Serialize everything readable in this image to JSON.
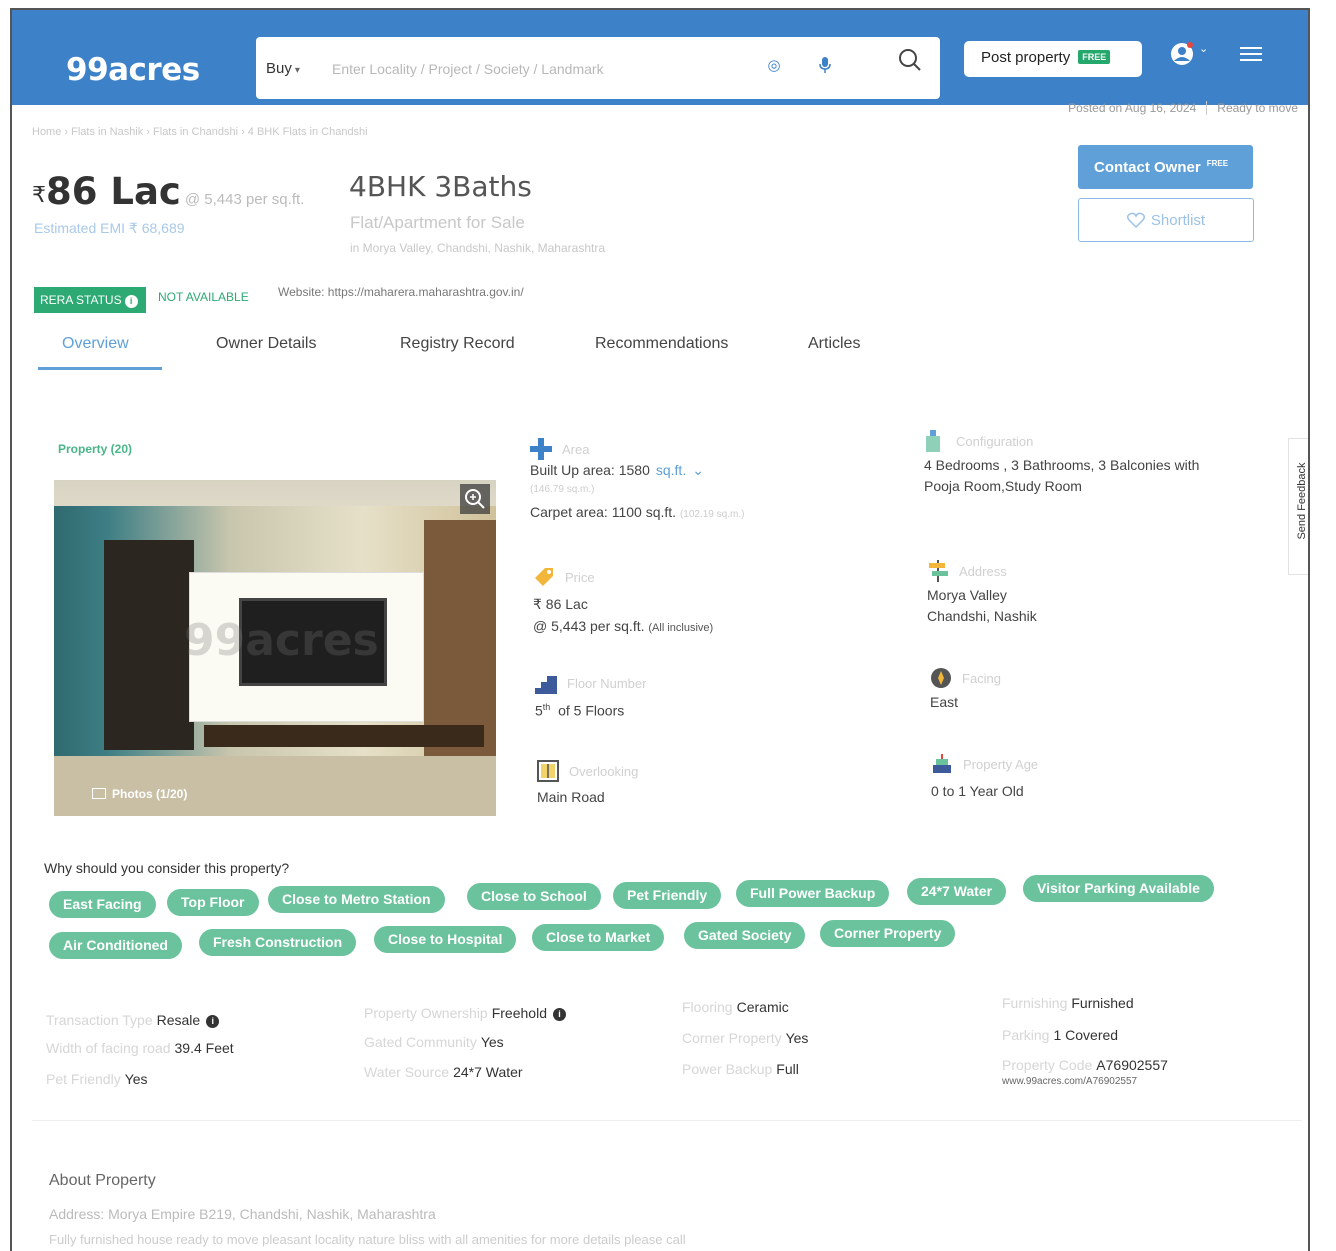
{
  "header": {
    "logo": "99acres",
    "buy_label": "Buy",
    "search_placeholder": "Enter Locality / Project / Society / Landmark",
    "post_property": "Post property",
    "free_tag": "FREE"
  },
  "meta": {
    "posted_on": "Posted on Aug 16, 2024",
    "status": "Ready to move"
  },
  "breadcrumb": "Home › Flats in Nashik › Flats in Chandshi › 4 BHK Flats in Chandshi",
  "listing": {
    "currency": "₹",
    "price": "86 Lac",
    "price_per_sqft": "@ 5,443 per sq.ft.",
    "emi": "Estimated EMI ₹ 68,689",
    "title": "4BHK 3Baths",
    "subtitle": "Flat/Apartment for Sale",
    "location": "in Morya Valley, Chandshi, Nashik, Maharashtra"
  },
  "actions": {
    "contact_owner": "Contact Owner",
    "contact_free": "FREE",
    "shortlist": "Shortlist"
  },
  "rera": {
    "badge": "RERA STATUS",
    "status": "NOT AVAILABLE",
    "website": "Website: https://maharera.maharashtra.gov.in/"
  },
  "tabs": [
    "Overview",
    "Owner Details",
    "Registry Record",
    "Recommendations",
    "Articles"
  ],
  "gallery": {
    "property_count": "Property (20)",
    "photos_label": "Photos (1/20)",
    "watermark": "99acres"
  },
  "specs": {
    "area": {
      "label": "Area",
      "built_up": "Built Up area: 1580",
      "unit_link": "sq.ft.",
      "built_up_sqm": "(146.79 sq.m.)",
      "carpet": "Carpet area: 1100 sq.ft.",
      "carpet_sqm": "(102.19 sq.m.)"
    },
    "configuration": {
      "label": "Configuration",
      "line1": "4 Bedrooms , 3 Bathrooms, 3 Balconies with",
      "line2": "Pooja Room,Study Room"
    },
    "price": {
      "label": "Price",
      "line1": "₹ 86 Lac",
      "line2": "@ 5,443 per sq.ft.",
      "inclusive": "(All inclusive)"
    },
    "address": {
      "label": "Address",
      "line1": "Morya Valley",
      "line2": "Chandshi, Nashik"
    },
    "floor": {
      "label": "Floor Number",
      "number": "5",
      "suffix": "th",
      "of_floors": "of 5 Floors"
    },
    "facing": {
      "label": "Facing",
      "value": "East"
    },
    "overlooking": {
      "label": "Overlooking",
      "value": "Main Road"
    },
    "age": {
      "label": "Property Age",
      "value": "0 to 1 Year Old"
    }
  },
  "why_title": "Why should you consider this property?",
  "highlights": [
    "East Facing",
    "Top Floor",
    "Close to Metro Station",
    "Close to School",
    "Pet Friendly",
    "Full Power Backup",
    "24*7 Water",
    "Visitor Parking Available",
    "Air Conditioned",
    "Fresh Construction",
    "Close to Hospital",
    "Close to Market",
    "Gated Society",
    "Corner Property"
  ],
  "details": {
    "transaction_type": {
      "k": "Transaction Type",
      "v": "Resale"
    },
    "facing_road": {
      "k": "Width of facing road",
      "v": "39.4 Feet"
    },
    "pet_friendly": {
      "k": "Pet Friendly",
      "v": "Yes"
    },
    "ownership": {
      "k": "Property Ownership",
      "v": "Freehold"
    },
    "gated": {
      "k": "Gated Community",
      "v": "Yes"
    },
    "water": {
      "k": "Water Source",
      "v": "24*7 Water"
    },
    "flooring": {
      "k": "Flooring",
      "v": "Ceramic"
    },
    "corner": {
      "k": "Corner Property",
      "v": "Yes"
    },
    "power": {
      "k": "Power Backup",
      "v": "Full"
    },
    "furnishing": {
      "k": "Furnishing",
      "v": "Furnished"
    },
    "parking": {
      "k": "Parking",
      "v": "1 Covered"
    },
    "code": {
      "k": "Property Code",
      "v": "A76902557"
    },
    "code_url": "www.99acres.com/A76902557"
  },
  "about": {
    "heading": "About Property",
    "address": "Address: Morya Empire B219, Chandshi, Nashik, Maharashtra",
    "description": "Fully furnished house ready to move pleasant locality nature bliss with all amenities for more details please call"
  },
  "feedback": "Send Feedback",
  "colors": {
    "header_blue": "#3d82c8",
    "accent_blue": "#5fa0d8",
    "chip_green": "#6bc39e",
    "rera_green": "#2daa74"
  }
}
